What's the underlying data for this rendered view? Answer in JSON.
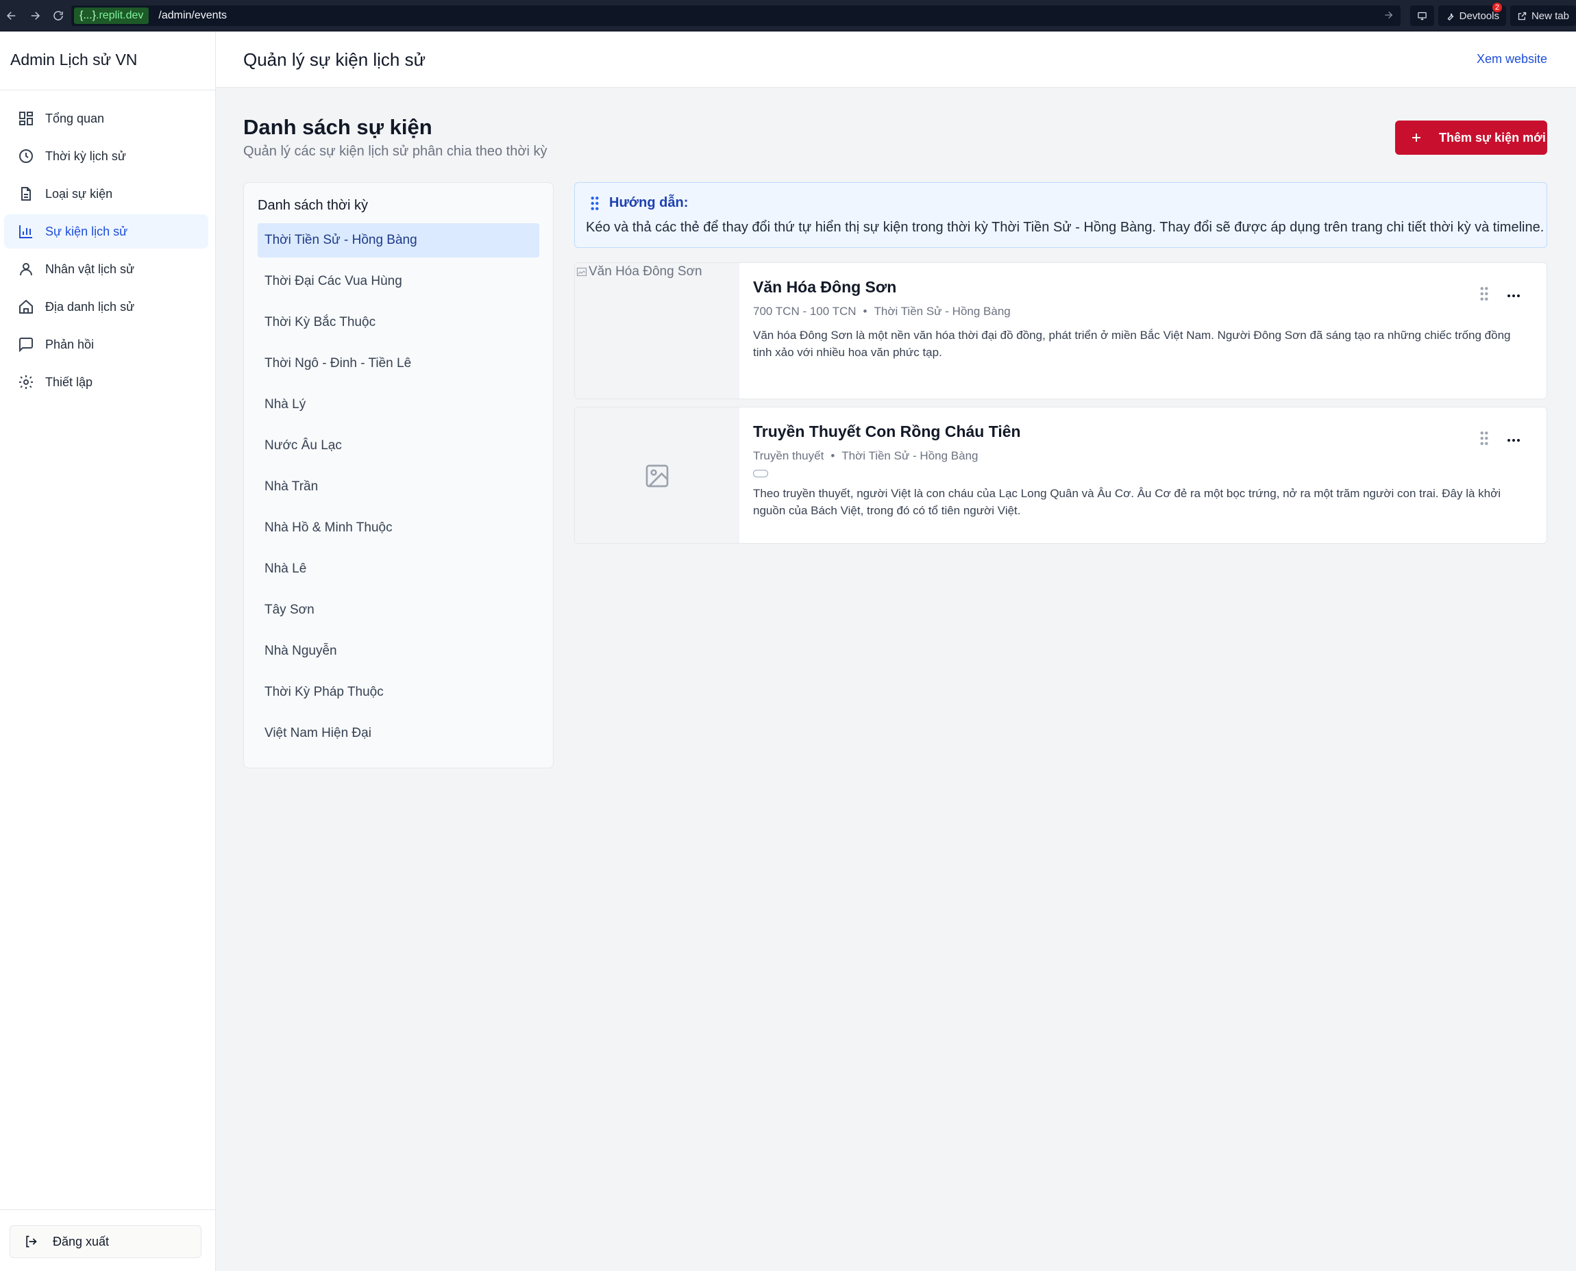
{
  "browser": {
    "url_domain_prefix": "{...}",
    "url_domain": ".replit.dev",
    "url_path": "/admin/events",
    "devtools_label": "Devtools",
    "devtools_badge": "2",
    "new_tab_label": "New tab"
  },
  "sidebar": {
    "brand": "Admin Lịch sử VN",
    "items": [
      {
        "label": "Tổng quan",
        "icon": "dashboard-icon"
      },
      {
        "label": "Thời kỳ lịch sử",
        "icon": "clock-icon"
      },
      {
        "label": "Loại sự kiện",
        "icon": "document-icon"
      },
      {
        "label": "Sự kiện lịch sử",
        "icon": "bar-chart-icon",
        "active": true
      },
      {
        "label": "Nhân vật lịch sử",
        "icon": "user-icon"
      },
      {
        "label": "Địa danh lịch sử",
        "icon": "home-icon"
      },
      {
        "label": "Phản hồi",
        "icon": "message-icon"
      },
      {
        "label": "Thiết lập",
        "icon": "gear-icon"
      }
    ],
    "logout_label": "Đăng xuất"
  },
  "topbar": {
    "title": "Quản lý sự kiện lịch sử",
    "view_site": "Xem website"
  },
  "main": {
    "title": "Danh sách sự kiện",
    "subtitle": "Quản lý các sự kiện lịch sử phân chia theo thời kỳ",
    "add_button": "Thêm sự kiện mới",
    "periods_title": "Danh sách thời kỳ",
    "periods": [
      "Thời Tiền Sử - Hồng Bàng",
      "Thời Đại Các Vua Hùng",
      "Thời Kỳ Bắc Thuộc",
      "Thời Ngô - Đinh - Tiền Lê",
      "Nhà Lý",
      "Nước Âu Lạc",
      "Nhà Trần",
      "Nhà Hồ & Minh Thuộc",
      "Nhà Lê",
      "Tây Sơn",
      "Nhà Nguyễn",
      "Thời Kỳ Pháp Thuộc",
      "Việt Nam Hiện Đại"
    ],
    "active_period": "Thời Tiền Sử - Hồng Bàng",
    "guide_title": "Hướng dẫn:",
    "guide_text": "Kéo và thả các thẻ để thay đổi thứ tự hiển thị sự kiện trong thời kỳ Thời Tiền Sử - Hồng Bàng. Thay đổi sẽ được áp dụng trên trang chi tiết thời kỳ và timeline.",
    "events": [
      {
        "image_alt": "Văn Hóa Đông Sơn",
        "title": "Văn Hóa Đông Sơn",
        "date": "700 TCN - 100 TCN",
        "period": "Thời Tiền Sử - Hồng Bàng",
        "description": "Văn hóa Đông Sơn là một nền văn hóa thời đại đồ đồng, phát triển ở miền Bắc Việt Nam. Người Đông Sơn đã sáng tạo ra những chiếc trống đồng tinh xảo với nhiều hoa văn phức tạp."
      },
      {
        "image_alt": "",
        "title": "Truyền Thuyết Con Rồng Cháu Tiên",
        "date": "Truyền thuyết",
        "period": "Thời Tiền Sử - Hồng Bàng",
        "description": "Theo truyền thuyết, người Việt là con cháu của Lạc Long Quân và Âu Cơ. Âu Cơ đẻ ra một bọc trứng, nở ra một trăm người con trai. Đây là khởi nguồn của Bách Việt, trong đó có tổ tiên người Việt."
      }
    ],
    "meta_separator": "•"
  },
  "colors": {
    "accent": "#c8102e",
    "link": "#1d4ed8",
    "active_bg": "#eff6ff",
    "period_active_bg": "#dbeafe"
  }
}
